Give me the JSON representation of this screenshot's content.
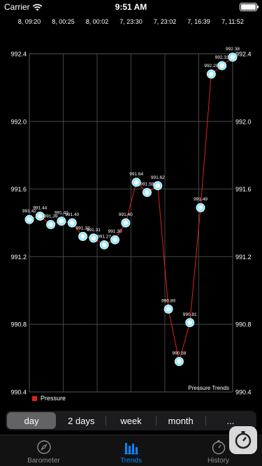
{
  "status_bar": {
    "carrier": "Carrier",
    "time": "9:51 AM",
    "battery_level": 1.0
  },
  "chart_title": "Pressure Trends",
  "legend": {
    "label": "Pressure",
    "color": "#e0201c"
  },
  "colors": {
    "background": "#000000",
    "line": "#e0201c",
    "marker": "#8ee8ff",
    "grid": "#555555",
    "accent": "#0a84ff"
  },
  "chart_data": {
    "type": "line",
    "title": "Pressure Trends",
    "xlabel": "",
    "ylabel": "",
    "ylim": [
      990.4,
      992.4
    ],
    "y_ticks": [
      "992.4",
      "992.0",
      "991.6",
      "991.2",
      "990.8",
      "990.4"
    ],
    "x_tick_labels": [
      "8, 09:20",
      "8, 00:25",
      "8, 00:02",
      "7, 23:30",
      "7, 23:02",
      "7, 16:39",
      "7, 11:52"
    ],
    "grid": true,
    "legend_position": "bottom-left",
    "series": [
      {
        "name": "Pressure",
        "values": [
          991.42,
          991.44,
          991.39,
          991.41,
          991.4,
          991.32,
          991.31,
          991.27,
          991.3,
          991.4,
          991.64,
          991.58,
          991.62,
          990.89,
          990.58,
          990.81,
          991.49,
          992.28,
          992.33,
          992.38
        ],
        "labels": [
          "991.42",
          "991.44",
          "991.39",
          "991.41",
          "991.40",
          "991.32",
          "991.31",
          "991.27",
          "991.30",
          "991.40",
          "991.64",
          "991.58",
          "991.62",
          "990.89",
          "990.58",
          "990.81",
          "991.49",
          "992.28",
          "992.33",
          "992.38"
        ]
      }
    ]
  },
  "segments": [
    {
      "label": "day",
      "selected": true
    },
    {
      "label": "2 days",
      "selected": false
    },
    {
      "label": "week",
      "selected": false
    },
    {
      "label": "month",
      "selected": false
    },
    {
      "label": "...",
      "selected": false
    }
  ],
  "tabs": [
    {
      "label": "Barometer",
      "icon": "compass-icon",
      "active": false
    },
    {
      "label": "Trends",
      "icon": "bar-chart-icon",
      "active": true
    },
    {
      "label": "History",
      "icon": "stopwatch-icon",
      "active": false
    }
  ],
  "overlay_icon": "stopwatch-icon"
}
